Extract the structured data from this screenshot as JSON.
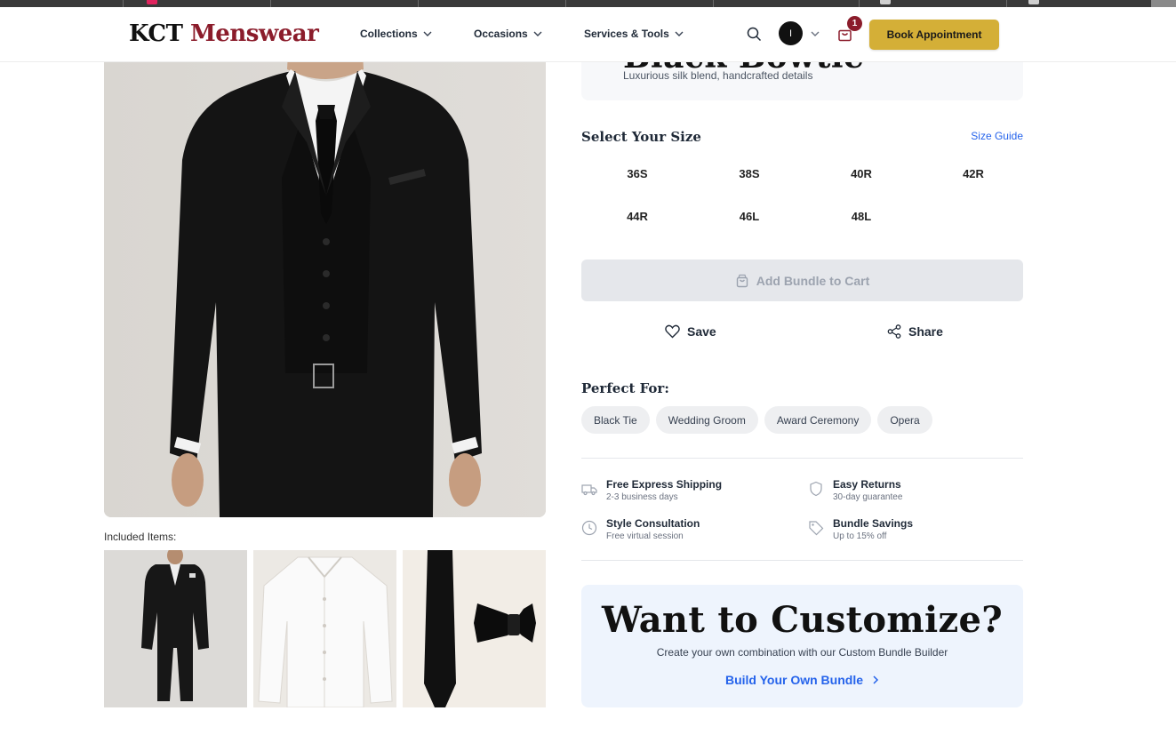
{
  "header": {
    "logo_part1": "KCT",
    "logo_part2": "Menswear",
    "nav": [
      {
        "label": "Collections"
      },
      {
        "label": "Occasions"
      },
      {
        "label": "Services & Tools"
      }
    ],
    "avatar_initial": "I",
    "cart_count": "1",
    "book_label": "Book Appointment"
  },
  "product": {
    "title": "Black Bowtie",
    "subtitle": "Luxurious silk blend, handcrafted details"
  },
  "size": {
    "heading": "Select Your Size",
    "guide": "Size Guide",
    "options": [
      "36S",
      "38S",
      "40R",
      "42R",
      "44R",
      "46L",
      "48L"
    ]
  },
  "actions": {
    "add_to_cart": "Add Bundle to Cart",
    "save": "Save",
    "share": "Share"
  },
  "perfect_for": {
    "heading": "Perfect For:",
    "tags": [
      "Black Tie",
      "Wedding Groom",
      "Award Ceremony",
      "Opera"
    ]
  },
  "features": [
    {
      "title": "Free Express Shipping",
      "sub": "2-3 business days",
      "icon": "truck-icon"
    },
    {
      "title": "Easy Returns",
      "sub": "30-day guarantee",
      "icon": "shield-icon"
    },
    {
      "title": "Style Consultation",
      "sub": "Free virtual session",
      "icon": "clock-icon"
    },
    {
      "title": "Bundle Savings",
      "sub": "Up to 15% off",
      "icon": "tag-icon"
    }
  ],
  "gallery": {
    "included_label": "Included Items:"
  },
  "customize": {
    "title": "Want to Customize?",
    "subtitle": "Create your own combination with our Custom Bundle Builder",
    "link": "Build Your Own Bundle"
  },
  "colors": {
    "brand_red": "#8b1c2b",
    "gold": "#d4af37",
    "link_blue": "#2563eb"
  }
}
